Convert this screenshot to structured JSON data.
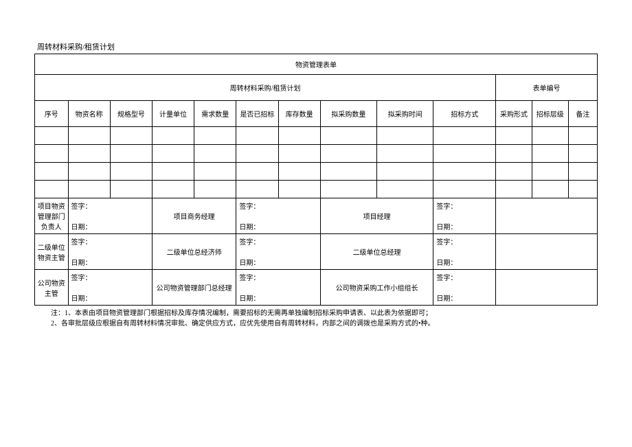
{
  "doc_title": "周转材料采购/租赁计划",
  "header": {
    "title_row1": "物资管理表单",
    "title_row2": "周转材料采购/租赁计划",
    "form_no_label": "表单编号"
  },
  "columns": {
    "c1": "序号",
    "c2": "物资名称",
    "c3": "规格型号",
    "c4": "计量单位",
    "c5": "需求数量",
    "c6": "是否已招标",
    "c7": "库存数量",
    "c8": "拟采购数量",
    "c9": "拟采购时间",
    "c10": "招标方式",
    "c11": "采购形式",
    "c12": "招标层级",
    "c13": "备注"
  },
  "sig": {
    "sign_label": "签字：",
    "date_label": "日期：",
    "r1a": "项目物资管理部门负责人",
    "r1b": "项目商务经理",
    "r1c": "项目经理",
    "r2a": "二级单位物资主管",
    "r2b": "二级单位总经济师",
    "r2c": "二级单位总经理",
    "r3a": "公司物资主管",
    "r3b": "公司物资管理部门总经理",
    "r3c": "公司物资采购工作小组组长"
  },
  "notes": {
    "prefix": "注：",
    "line1": "1、本表由项目物资管理部门根据招标及库存情况编制，需要招标的无需再单独编制招标采购申请表、以此表为依据即可；",
    "line2": "2、各审批层级应根据自有周转材料情况审批、确定供应方式，应优先使用自有周转材料，内部之间的调拨也是采购方式的•种。"
  }
}
